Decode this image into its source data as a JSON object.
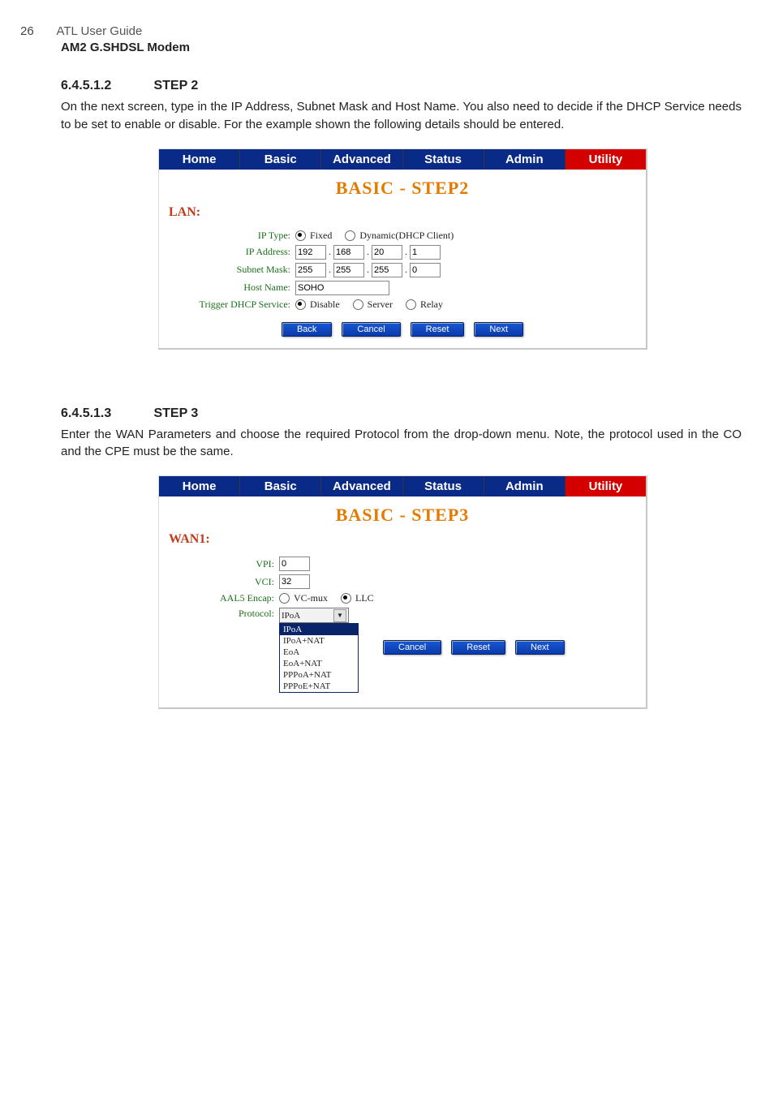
{
  "header": {
    "page_number": "26",
    "guide_title": "ATL User Guide",
    "subtitle": "AM2 G.SHDSL Modem"
  },
  "step2": {
    "num": "6.4.5.1.2",
    "name": "STEP 2",
    "body": "On the next screen, type in the IP Address, Subnet Mask and Host Name. You also need to decide if the DHCP Service needs to be set to enable or disable. For the example shown the following details should be entered."
  },
  "tabs": [
    "Home",
    "Basic",
    "Advanced",
    "Status",
    "Admin",
    "Utility"
  ],
  "shot2": {
    "title": "BASIC - STEP2",
    "lan_label": "LAN:",
    "labels": {
      "iptype": "IP Type:",
      "ipaddr": "IP Address:",
      "subnet": "Subnet Mask:",
      "host": "Host Name:",
      "dhcp": "Trigger DHCP Service:"
    },
    "iptype_fixed": "Fixed",
    "iptype_dyn": "Dynamic(DHCP Client)",
    "ip": [
      "192",
      "168",
      "20",
      "1"
    ],
    "mask": [
      "255",
      "255",
      "255",
      "0"
    ],
    "hostname": "SOHO",
    "dhcp_disable": "Disable",
    "dhcp_server": "Server",
    "dhcp_relay": "Relay",
    "buttons": {
      "back": "Back",
      "cancel": "Cancel",
      "reset": "Reset",
      "next": "Next"
    }
  },
  "step3": {
    "num": "6.4.5.1.3",
    "name": "STEP 3",
    "body": "Enter the WAN Parameters and choose the required Protocol from the drop-down menu. Note, the protocol used in the CO and the CPE must be the same."
  },
  "shot3": {
    "title": "BASIC - STEP3",
    "wan_label": "WAN1:",
    "labels": {
      "vpi": "VPI:",
      "vci": "VCI:",
      "aal5": "AAL5 Encap:",
      "proto": "Protocol:"
    },
    "vpi": "0",
    "vci": "32",
    "aal5_vcmux": "VC-mux",
    "aal5_llc": "LLC",
    "proto_sel": "IPoA",
    "proto_opts": [
      "IPoA",
      "IPoA+NAT",
      "EoA",
      "EoA+NAT",
      "PPPoA+NAT",
      "PPPoE+NAT"
    ],
    "buttons": {
      "cancel": "Cancel",
      "reset": "Reset",
      "next": "Next"
    }
  }
}
